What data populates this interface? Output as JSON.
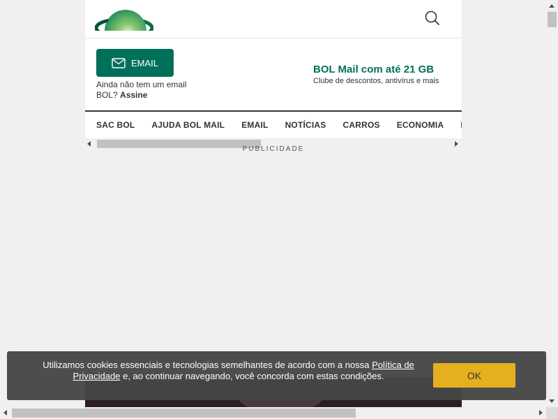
{
  "header": {
    "logo_name": "bol-logo",
    "search_icon": "search-icon"
  },
  "mail": {
    "button_label": "EMAIL",
    "button_icon": "mail-icon",
    "signup_text": "Ainda não tem um email BOL?",
    "signup_link": "Assine",
    "promo_title": "BOL Mail com até 21 GB",
    "promo_subtitle": "Clube de descontos, antivírus e mais"
  },
  "nav": {
    "items": [
      "SAC BOL",
      "AJUDA BOL MAIL",
      "EMAIL",
      "NOTÍCIAS",
      "CARROS",
      "ECONOMIA",
      "ESPORTE"
    ]
  },
  "ad": {
    "label": "PUBLICIDADE"
  },
  "cookie": {
    "text_before": "Utilizamos cookies essenciais e tecnologias semelhantes de acordo com a nossa",
    "policy_link": "Política de Privacidade",
    "text_after": "e, ao continuar navegando, você concorda com estas condições.",
    "ok_label": "OK"
  },
  "colors": {
    "brand_green": "#00705a",
    "ok_yellow": "#e5b01f",
    "cookie_bg": "#464646"
  }
}
